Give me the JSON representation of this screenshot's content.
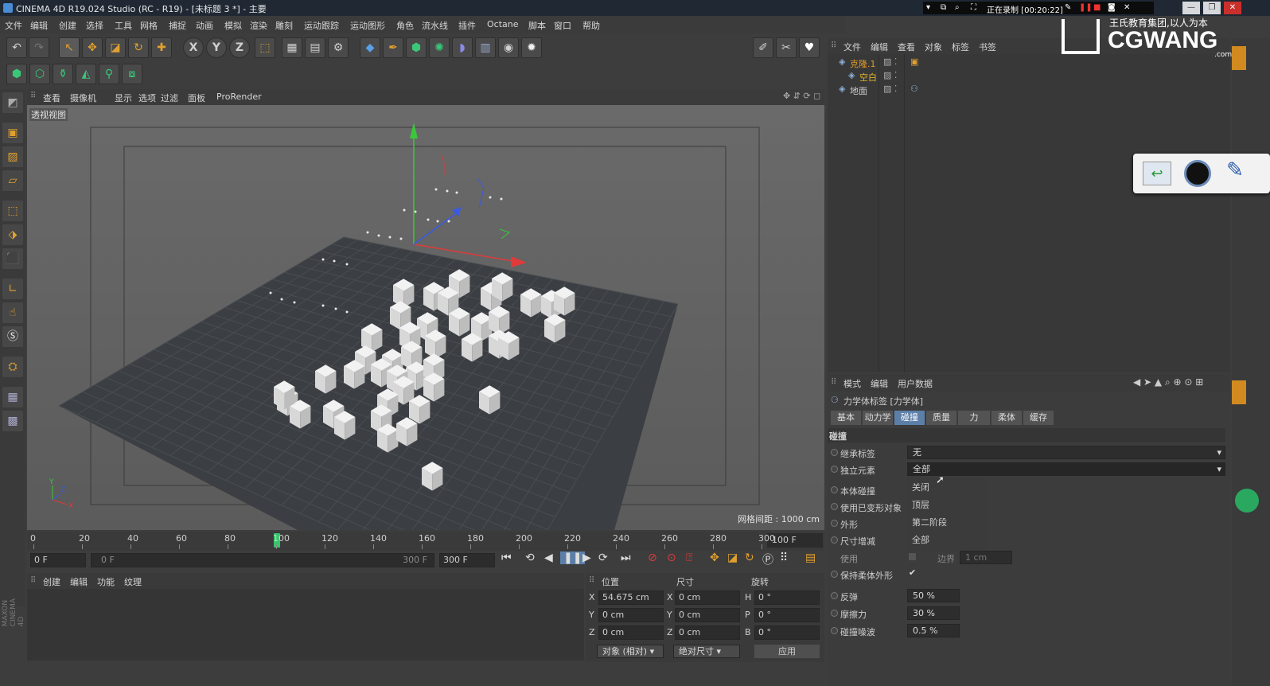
{
  "window": {
    "title": "CINEMA 4D R19.024 Studio (RC - R19) - [未标题 3 *] - 主要",
    "recording_label": "正在录制 [00:20:22]"
  },
  "watermark": {
    "line1": "王氏教育集团,以人为本",
    "line2": "CGWANG",
    "line3": ".com"
  },
  "menubar": [
    "文件",
    "编辑",
    "创建",
    "选择",
    "工具",
    "网格",
    "捕捉",
    "动画",
    "模拟",
    "渲染",
    "雕刻",
    "运动跟踪",
    "运动图形",
    "角色",
    "流水线",
    "插件",
    "Octane",
    "脚本",
    "窗口",
    "帮助"
  ],
  "viewport": {
    "menu": [
      "查看",
      "摄像机",
      "显示",
      "选项",
      "过滤",
      "面板",
      "ProRender"
    ],
    "view_name": "透视视图",
    "grid_spacing": "网格间距 : 1000 cm"
  },
  "timeline": {
    "ticks": [
      "0",
      "20",
      "40",
      "60",
      "80",
      "100",
      "120",
      "140",
      "160",
      "180",
      "200",
      "220",
      "240",
      "260",
      "280",
      "300"
    ],
    "end_field": "100 F",
    "current_frame": "0 F",
    "range_start": "0 F",
    "range_end_inner": "300 F",
    "range_end": "300 F"
  },
  "material_panel": {
    "menu": [
      "创建",
      "编辑",
      "功能",
      "纹理"
    ]
  },
  "coords": {
    "headers": [
      "位置",
      "尺寸",
      "旋转"
    ],
    "rows": [
      {
        "axis": "X",
        "pos": "54.675 cm",
        "size_axis": "X",
        "size": "0 cm",
        "rot_axis": "H",
        "rot": "0 °"
      },
      {
        "axis": "Y",
        "pos": "0 cm",
        "size_axis": "Y",
        "size": "0 cm",
        "rot_axis": "P",
        "rot": "0 °"
      },
      {
        "axis": "Z",
        "pos": "0 cm",
        "size_axis": "Z",
        "size": "0 cm",
        "rot_axis": "B",
        "rot": "0 °"
      }
    ],
    "mode_select": "对象 (相对)",
    "size_select": "绝对尺寸",
    "apply": "应用"
  },
  "object_manager": {
    "menu": [
      "文件",
      "编辑",
      "查看",
      "对象",
      "标签",
      "书签"
    ],
    "objects": [
      {
        "name": "克隆.1",
        "color": "#e09a2a"
      },
      {
        "name": "空白",
        "color": "#e0b02a"
      },
      {
        "name": "地面",
        "color": "#cfcfcf"
      }
    ]
  },
  "attributes": {
    "menu": [
      "模式",
      "编辑",
      "用户数据"
    ],
    "title": "力学体标签 [力学体]",
    "tabs": [
      "基本",
      "动力学",
      "碰撞",
      "质量",
      "力",
      "柔体",
      "缓存"
    ],
    "active_tab": "碰撞",
    "section": "碰撞",
    "props": {
      "inherit_label": "继承标签",
      "inherit_value": "无",
      "individual_label": "独立元素",
      "individual_value": "全部",
      "self_collision": "本体碰撞",
      "use_deformed": "使用已变形对象",
      "shape": "外形",
      "size_increment": "尺寸增减",
      "use": "使用",
      "border": "边界",
      "border_value": "1 cm",
      "keep_soft_shape": "保持柔体外形",
      "bounce": "反弹",
      "bounce_value": "50 %",
      "friction": "摩擦力",
      "friction_value": "30 %",
      "collision_noise": "碰撞噪波",
      "collision_noise_value": "0.5 %"
    },
    "dropdown_options": [
      "关闭",
      "顶层",
      "第二阶段",
      "全部"
    ]
  },
  "maxon_logo": "MAXON CINEMA 4D",
  "colors": {
    "accent_tab": "#5c7fa8",
    "axis_x": "#e03a3a",
    "axis_y": "#3ac83a",
    "axis_z": "#3a5ae0",
    "playhead": "#35c66b"
  }
}
